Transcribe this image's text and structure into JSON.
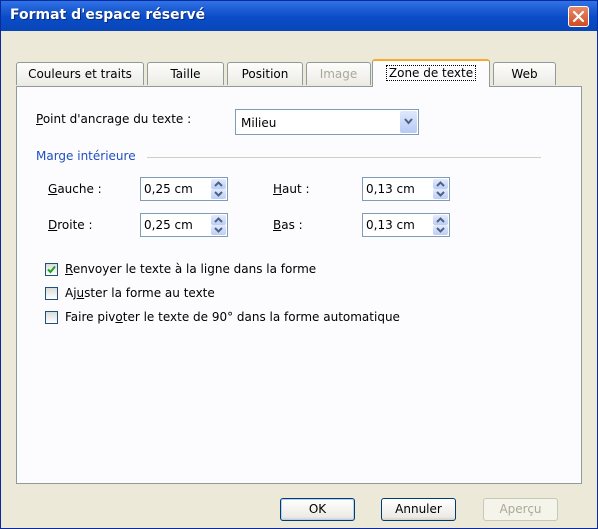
{
  "window": {
    "title": "Format d'espace réservé"
  },
  "tabs": [
    {
      "label": "Couleurs et traits",
      "state": "normal"
    },
    {
      "label": "Taille",
      "state": "normal"
    },
    {
      "label": "Position",
      "state": "normal"
    },
    {
      "label": "Image",
      "state": "disabled"
    },
    {
      "label": "Zone de texte",
      "state": "active"
    },
    {
      "label": "Web",
      "state": "normal"
    }
  ],
  "anchor": {
    "label_u": "P",
    "label_rest": "oint d'ancrage du texte :",
    "value": "Milieu"
  },
  "margins": {
    "group_title": "Marge intérieure",
    "left": {
      "label_u": "G",
      "label_rest": "auche :",
      "value": "0,25 cm"
    },
    "right": {
      "label_u": "D",
      "label_rest": "roite :",
      "value": "0,25 cm"
    },
    "top": {
      "label_u": "H",
      "label_rest": "aut :",
      "value": "0,13 cm"
    },
    "bottom": {
      "label_u": "B",
      "label_rest": "as :",
      "value": "0,13 cm"
    }
  },
  "options": {
    "wrap": {
      "u": "R",
      "rest": "envoyer le texte à la ligne dans la forme",
      "checked": true
    },
    "fit": {
      "pre": "Aj",
      "u": "u",
      "rest": "ster la forme au texte",
      "checked": false
    },
    "rotate": {
      "pre": "Faire piv",
      "u": "o",
      "rest": "ter le texte de 90° dans la forme automatique",
      "checked": false
    }
  },
  "buttons": {
    "ok": "OK",
    "cancel": "Annuler",
    "preview": "Aperçu"
  },
  "colors": {
    "titlebar": "#0a4cc8",
    "accent": "#1f4fbf",
    "tab_highlight": "#f5aa2c",
    "close": "#d14b23"
  }
}
